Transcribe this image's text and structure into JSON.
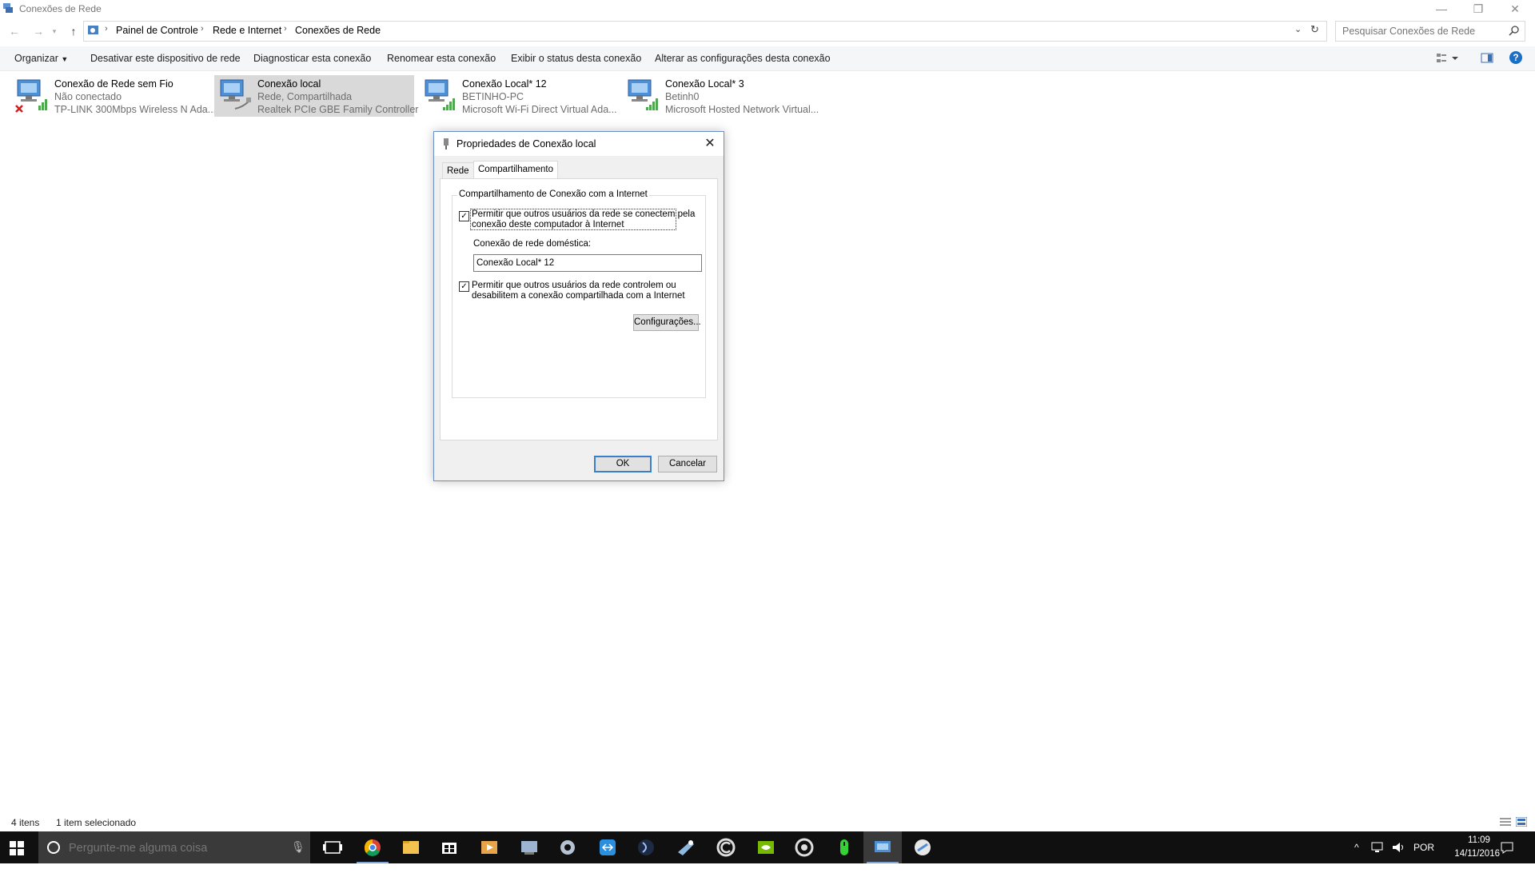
{
  "window": {
    "title": "Conexões de Rede",
    "buttons": [
      "—",
      "❐",
      "✕"
    ]
  },
  "breadcrumb": [
    "Painel de Controle",
    "Rede e Internet",
    "Conexões de Rede"
  ],
  "search": {
    "placeholder": "Pesquisar Conexões de Rede"
  },
  "toolbar": {
    "organize": "Organizar",
    "disable": "Desativar este dispositivo de rede",
    "diagnose": "Diagnosticar esta conexão",
    "rename": "Renomear esta conexão",
    "status": "Exibir o status desta conexão",
    "change": "Alterar as configurações desta conexão",
    "help": "?"
  },
  "connections": [
    {
      "name": "Conexão de Rede sem Fio",
      "status": "Não conectado",
      "device": "TP-LINK 300Mbps Wireless N Ada...",
      "selected": false,
      "icon": "wifi-disconnected-icon"
    },
    {
      "name": "Conexão local",
      "status": "Rede, Compartilhada",
      "device": "Realtek PCIe GBE Family Controller",
      "selected": true,
      "icon": "ethernet-icon"
    },
    {
      "name": "Conexão Local* 12",
      "status": "BETINHO-PC",
      "device": "Microsoft Wi-Fi Direct Virtual Ada...",
      "selected": false,
      "icon": "wifi-icon"
    },
    {
      "name": "Conexão Local* 3",
      "status": "Betinh0",
      "device": "Microsoft Hosted Network Virtual...",
      "selected": false,
      "icon": "wifi-icon"
    }
  ],
  "statusbar": {
    "count": "4 itens",
    "selected": "1 item selecionado"
  },
  "dialog": {
    "title": "Propriedades de Conexão local",
    "tabs": [
      "Rede",
      "Compartilhamento"
    ],
    "active_tab": "Compartilhamento",
    "group_title": "Compartilhamento de Conexão com a Internet",
    "allow_connect_line1": "Permitir que outros usuários da rede se conectem pela",
    "allow_connect_line2": "conexão deste computador à Internet",
    "allow_connect_checked": true,
    "home_network_label": "Conexão de rede doméstica:",
    "home_network_value": "Conexão Local* 12",
    "allow_control_line1": "Permitir que outros usuários da rede controlem ou",
    "allow_control_line2": "desabilitem a conexão compartilhada com a Internet",
    "allow_control_checked": true,
    "settings_button": "Configurações...",
    "ok_button": "OK",
    "cancel_button": "Cancelar"
  },
  "taskbar": {
    "search_placeholder": "Pergunte-me alguma coisa",
    "language": "POR",
    "time": "11:09",
    "date": "14/11/2016"
  },
  "colors": {
    "accent": "#3c7fc9",
    "taskbar": "#101010",
    "selection": "#d9d9d9"
  }
}
